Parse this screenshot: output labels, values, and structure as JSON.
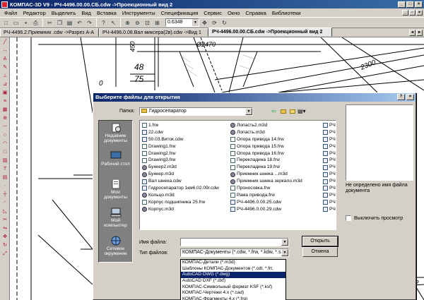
{
  "app": {
    "title": "КОМПАС-3D V9 - РЧ-4496.00.00.СБ.cdw ->Проекционный вид 2"
  },
  "menu": [
    "Файл",
    "Редактор",
    "Выделить",
    "Вид",
    "Вставка",
    "Инструменты",
    "Спецификация",
    "Сервис",
    "Окно",
    "Справка",
    "Библиотеки"
  ],
  "toolbar": {
    "zoom_value": "0.6348"
  },
  "tabs": [
    {
      "label": "РЧ-4496.2.Приемник .cdw ->Разрез А-А",
      "active": false
    },
    {
      "label": "РЧ-4496.0.08.Вал миксера(2в).cdw ->Вид 1",
      "active": false
    },
    {
      "label": "РЧ-4496.00.00.СБ.cdw ->Проекционный вид 2",
      "active": true
    }
  ],
  "drawing": {
    "labels": [
      "48",
      "75",
      "2300",
      "450",
      "Ø2470",
      "0",
      "17",
      "2"
    ]
  },
  "dialog": {
    "title": "Выберите файлы для открытия",
    "folder_label": "Папка:",
    "folder_value": "Гидросепаратор",
    "places": [
      "Недавние документы",
      "Рабочий стол",
      "Мои документы",
      "Мой компьютер",
      "Сетевое окружение"
    ],
    "files_col1": [
      {
        "name": "1.frw",
        "type": "frw"
      },
      {
        "name": "22.cdw",
        "type": "cdw"
      },
      {
        "name": "50.03.Виток.cdw",
        "type": "cdw"
      },
      {
        "name": "Drawing1.frw",
        "type": "frw"
      },
      {
        "name": "Drawing2.frw",
        "type": "frw"
      },
      {
        "name": "Drawing3.frw",
        "type": "frw"
      },
      {
        "name": "Бункер2.m3d",
        "type": "m3d"
      },
      {
        "name": "Бункер.m3d",
        "type": "m3d"
      },
      {
        "name": "Вал шнека.cdw",
        "type": "cdw"
      },
      {
        "name": "Гидросепаратор 1км6.02.09г.cdw",
        "type": "cdw"
      },
      {
        "name": "Кольцо.m3d",
        "type": "m3d"
      },
      {
        "name": "Корпус подшипника 25.frw",
        "type": "frw"
      },
      {
        "name": "Корпус.m3d",
        "type": "m3d"
      }
    ],
    "files_col2": [
      {
        "name": "Лопасть2.m3d",
        "type": "m3d"
      },
      {
        "name": "Лопасть.m3d",
        "type": "m3d"
      },
      {
        "name": "Опора привода 14.frw",
        "type": "frw"
      },
      {
        "name": "Опора привода 15.frw",
        "type": "frw"
      },
      {
        "name": "Опора привода 16.frw",
        "type": "frw"
      },
      {
        "name": "Перекладина 18.frw",
        "type": "frw"
      },
      {
        "name": "Перекладина 19.frw",
        "type": "frw"
      },
      {
        "name": "Приемник шнека ...m3d",
        "type": "m3d"
      },
      {
        "name": "Приемник шнека зеркало.m3d",
        "type": "m3d"
      },
      {
        "name": "Проносовка.frw",
        "type": "frw"
      },
      {
        "name": "Рама привода.frw",
        "type": "frw"
      },
      {
        "name": "РЧ-4496.0.00.25.cdw",
        "type": "cdw"
      },
      {
        "name": "РЧ-4496.0.00.29.cdw",
        "type": "cdw"
      }
    ],
    "files_col3": [
      {
        "name": "РЧ-",
        "type": "cdw"
      },
      {
        "name": "РЧ-",
        "type": "cdw"
      },
      {
        "name": "РЧ-",
        "type": "cdw"
      },
      {
        "name": "РЧ-",
        "type": "cdw"
      },
      {
        "name": "РЧ-",
        "type": "cdw"
      },
      {
        "name": "РЧ-",
        "type": "cdw"
      },
      {
        "name": "РЧ-",
        "type": "cdw"
      },
      {
        "name": "РЧ-",
        "type": "cdw"
      },
      {
        "name": "РЧ-",
        "type": "cdw"
      },
      {
        "name": "РЧ-",
        "type": "cdw"
      },
      {
        "name": "РЧ-",
        "type": "cdw"
      },
      {
        "name": "РЧ-",
        "type": "cdw"
      },
      {
        "name": "РЧ-",
        "type": "cdw"
      }
    ],
    "preview_note": "Не определено имя файла документа",
    "disable_preview_label": "Выключить просмотр",
    "filename_label": "Имя файла:",
    "filename_value": "",
    "filetype_label": "Тип файлов:",
    "filetype_value": "КОМПАС-Документы (*.cdw, *.frw, *.kdw, *.sp",
    "open_button": "Открыть",
    "cancel_button": "Отмена",
    "filetype_options": [
      {
        "label": "КОМПАС-Детали (*.m3d)",
        "selected": false
      },
      {
        "label": "Шаблоны КОМПАС-Документов (*.cdt, *.frt,",
        "selected": false
      },
      {
        "label": "AutoCAD DWG (*.dwg)",
        "selected": true
      },
      {
        "label": "AutoCAD DXF (*.dxf)",
        "selected": false
      },
      {
        "label": "КОМПАС-Символьный формат KSF (*.ksf)",
        "selected": false
      },
      {
        "label": "КОМПАС-Чертежи 4.x (*.cad)",
        "selected": false
      },
      {
        "label": "КОМПАС-Фрагменты 4.x (*.frg)",
        "selected": false
      }
    ]
  }
}
